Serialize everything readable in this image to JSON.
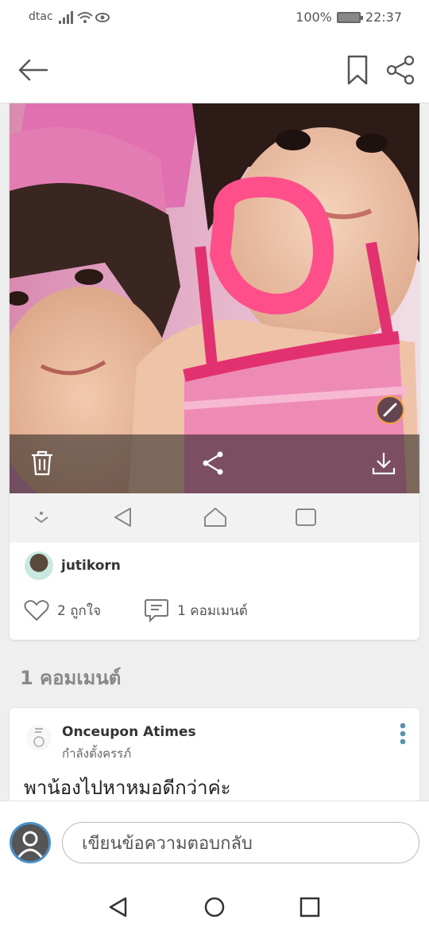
{
  "status": {
    "carrier": "dtac",
    "battery": "100%",
    "time": "22:37"
  },
  "post": {
    "author": "jutikorn",
    "likes": "2 ถูกใจ",
    "comments": "1 คอมเมนต์"
  },
  "comments_heading": "1 คอมเมนต์",
  "comment": {
    "name": "Onceupon Atimes",
    "status": "กำลังตั้งครรภ์",
    "text": "พาน้องไปหาหมอดีกว่าค่ะ"
  },
  "reply": {
    "placeholder": "เขียนข้อความตอบกลับ"
  },
  "colors": {
    "circle_mark": "#ff4f8b",
    "accent": "#4a90c8"
  }
}
